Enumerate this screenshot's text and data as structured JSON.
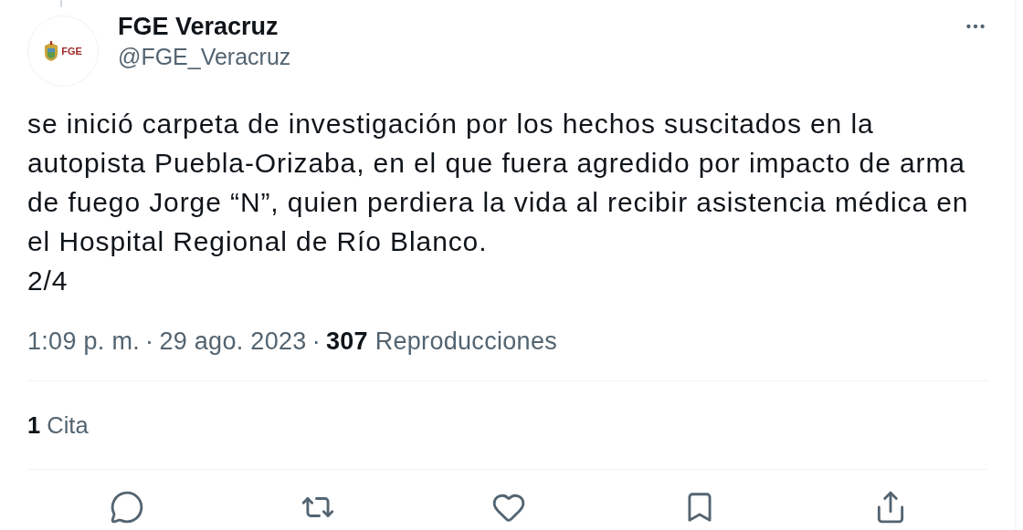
{
  "author": {
    "name": "FGE Veracruz",
    "handle": "@FGE_Veracruz",
    "avatar": {
      "acronym": "FGE"
    }
  },
  "tweet": {
    "text": "se inició carpeta de investigación por los hechos suscitados en la\nautopista Puebla-Orizaba, en el que fuera agredido por impacto de arma\nde fuego Jorge “N”, quien perdiera la vida al recibir asistencia médica en\nel Hospital Regional de Río Blanco.\n2/4"
  },
  "meta": {
    "time": "1:09 p. m.",
    "separator": "·",
    "date": "29 ago. 2023",
    "views_count": "307",
    "views_label": "Reproducciones"
  },
  "stats": [
    {
      "count": "1",
      "label": "Cita"
    }
  ],
  "actions": [
    {
      "kind": "reply"
    },
    {
      "kind": "retweet"
    },
    {
      "kind": "like"
    },
    {
      "kind": "bookmark"
    },
    {
      "kind": "share"
    }
  ]
}
